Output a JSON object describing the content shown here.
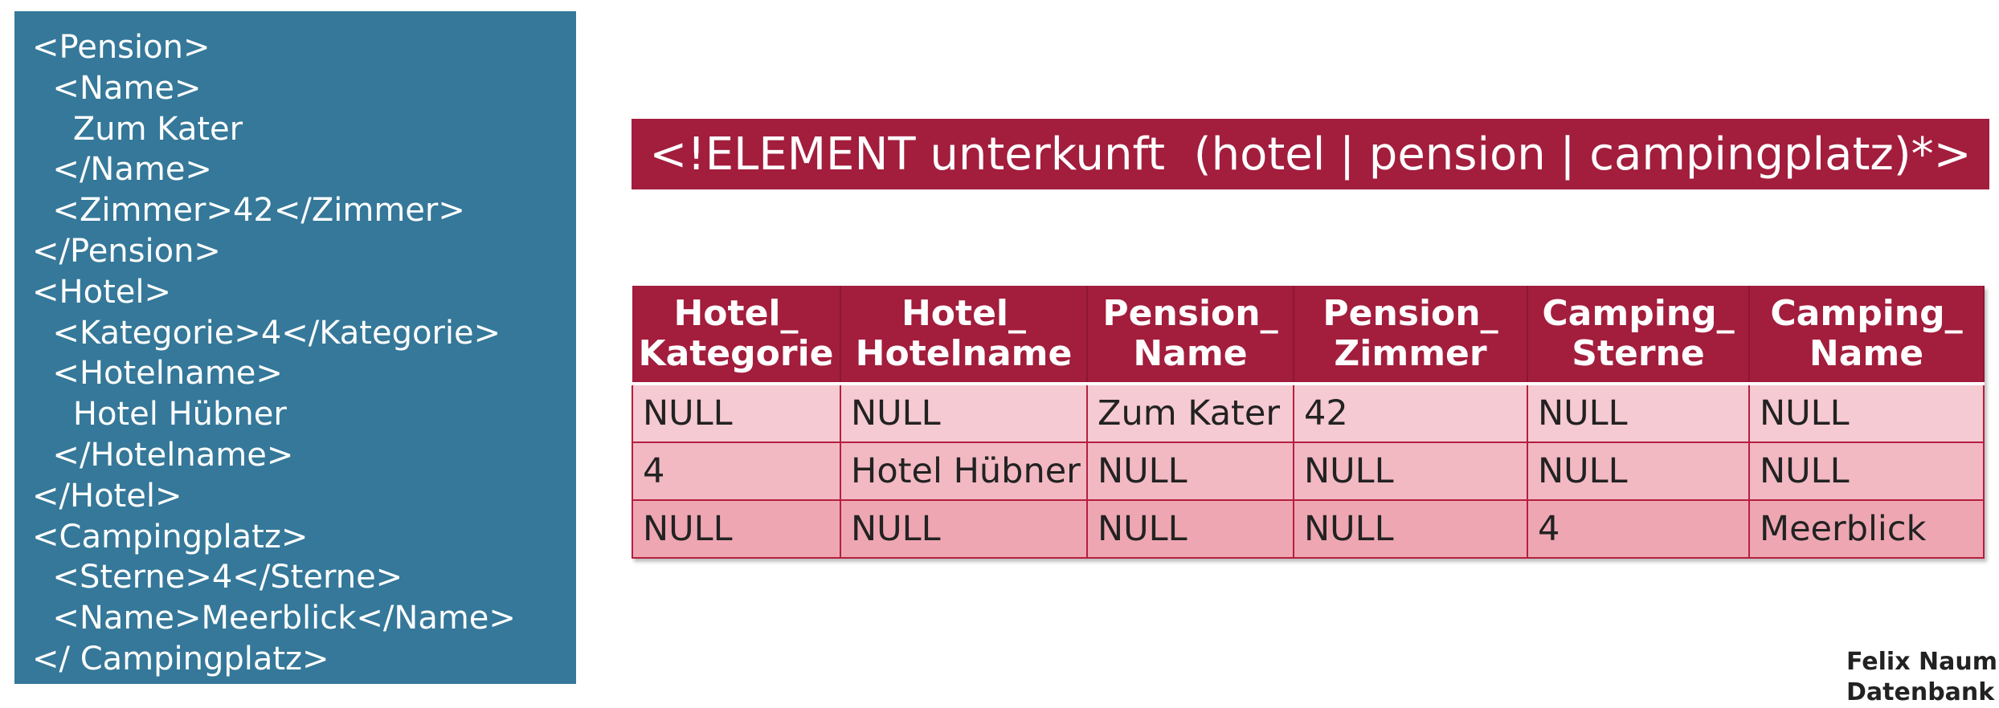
{
  "xml_code": [
    "<Pension>",
    "  <Name>",
    "    Zum Kater",
    "  </Name>",
    "  <Zimmer>42</Zimmer>",
    "</Pension>",
    "<Hotel>",
    "  <Kategorie>4</Kategorie>",
    "  <Hotelname>",
    "    Hotel Hübner",
    "  </Hotelname>",
    "</Hotel>",
    "<Campingplatz>",
    "  <Sterne>4</Sterne>",
    "  <Name>Meerblick</Name>",
    "</ Campingplatz>"
  ],
  "dtd_declaration": "<!ELEMENT unterkunft  (hotel | pension | campingplatz)*>",
  "table": {
    "headers": [
      "Hotel_\nKategorie",
      "Hotel_\nHotelname",
      "Pension_\nName",
      "Pension_\nZimmer",
      "Camping_\nSterne",
      "Camping_\nName"
    ],
    "rows": [
      [
        "NULL",
        "NULL",
        "Zum Kater",
        "42",
        "NULL",
        "NULL"
      ],
      [
        "4",
        "Hotel Hübner",
        "NULL",
        "NULL",
        "NULL",
        "NULL"
      ],
      [
        "NULL",
        "NULL",
        "NULL",
        "NULL",
        "4",
        "Meerblick"
      ]
    ]
  },
  "footer": {
    "line1": "Felix Naum",
    "line2": "Datenbank"
  },
  "colors": {
    "xml_background": "#357899",
    "accent": "#a31d3d",
    "row_light": "#f6cad2",
    "row_mid": "#f2b9c3",
    "row_dark": "#eea7b2"
  }
}
